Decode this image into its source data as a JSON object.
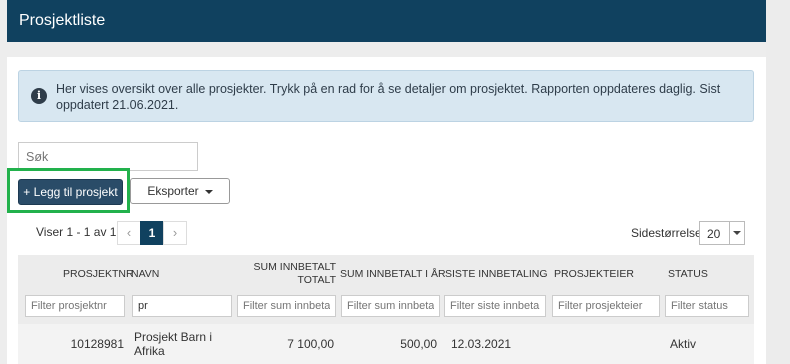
{
  "header": {
    "title": "Prosjektliste"
  },
  "info": {
    "icon": "info-icon",
    "text": "Her vises oversikt over alle prosjekter. Trykk på en rad for å se detaljer om prosjektet. Rapporten oppdateres daglig. Sist oppdatert 21.06.2021."
  },
  "search": {
    "placeholder": "Søk",
    "value": ""
  },
  "toolbar": {
    "add_label": "+ Legg til prosjekt",
    "export_label": "Eksporter"
  },
  "pagination": {
    "showing": "Viser 1 - 1 av 1",
    "prev": "‹",
    "current": "1",
    "next": "›",
    "page_size_label": "Sidestørrelse:",
    "page_size": "20"
  },
  "table": {
    "columns": [
      {
        "label": "PROSJEKTNR",
        "filter_placeholder": "Filter prosjektnr",
        "filter_value": ""
      },
      {
        "label": "NAVN",
        "filter_placeholder": "",
        "filter_value": "pr"
      },
      {
        "label_line1": "SUM INNBETALT",
        "label_line2": "TOTALT",
        "filter_placeholder": "Filter sum innbetal",
        "filter_value": ""
      },
      {
        "label": "SUM INNBETALT I ÅR",
        "filter_placeholder": "Filter sum innbetal",
        "filter_value": ""
      },
      {
        "label": "SISTE INNBETALING",
        "filter_placeholder": "Filter siste innbetali",
        "filter_value": ""
      },
      {
        "label": "PROSJEKTEIER",
        "filter_placeholder": "Filter prosjekteier",
        "filter_value": ""
      },
      {
        "label": "STATUS",
        "filter_placeholder": "Filter status",
        "filter_value": ""
      }
    ],
    "rows": [
      {
        "prosjektnr": "10128981",
        "navn_line1": "Prosjekt Barn i",
        "navn_line2": "Afrika",
        "sum_totalt": "7 100,00",
        "sum_i_ar": "500,00",
        "siste_innbetaling": "12.03.2021",
        "prosjekteier": "",
        "status": "Aktiv"
      }
    ]
  }
}
